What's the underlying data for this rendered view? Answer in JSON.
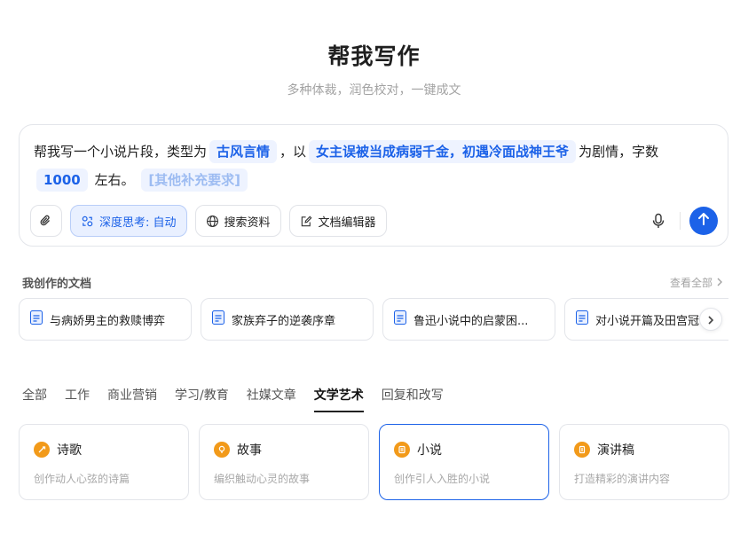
{
  "header": {
    "title": "帮我写作",
    "subtitle": "多种体裁，润色校对，一键成文"
  },
  "composer": {
    "prompt_text_1": "帮我写一个小说片段，类型为",
    "chip_genre": "古风言情",
    "prompt_text_2": "，以",
    "chip_plot": "女主误被当成病弱千金，初遇冷面战神王爷",
    "prompt_text_3": "为剧情，字数",
    "chip_words": "1000",
    "prompt_text_4": "左右。",
    "chip_extra": "[其他补充要求]",
    "tools": {
      "attach_icon": "paperclip-icon",
      "deep_think_label": "深度思考: 自动",
      "search_label": "搜索资料",
      "editor_label": "文档编辑器"
    },
    "mic_icon": "microphone-icon",
    "send_icon": "arrow-up-icon"
  },
  "my_docs": {
    "title": "我创作的文档",
    "view_all": "查看全部",
    "items": [
      {
        "label": "与病娇男主的救赎博弈"
      },
      {
        "label": "家族弃子的逆袭序章"
      },
      {
        "label": "鲁迅小说中的启蒙困..."
      },
      {
        "label": "对小说开篇及田宫冠"
      }
    ]
  },
  "tabs": [
    {
      "label": "全部"
    },
    {
      "label": "工作"
    },
    {
      "label": "商业营销"
    },
    {
      "label": "学习/教育"
    },
    {
      "label": "社媒文章"
    },
    {
      "label": "文学艺术",
      "active": true
    },
    {
      "label": "回复和改写"
    }
  ],
  "categories": [
    {
      "title": "诗歌",
      "desc": "创作动人心弦的诗篇",
      "icon": "poem-icon"
    },
    {
      "title": "故事",
      "desc": "编织触动心灵的故事",
      "icon": "lightbulb-icon"
    },
    {
      "title": "小说",
      "desc": "创作引人入胜的小说",
      "icon": "book-icon",
      "selected": true
    },
    {
      "title": "演讲稿",
      "desc": "打造精彩的演讲内容",
      "icon": "document-icon"
    }
  ],
  "colors": {
    "accent": "#1c62e8",
    "category_icon": "#f29a1a"
  }
}
